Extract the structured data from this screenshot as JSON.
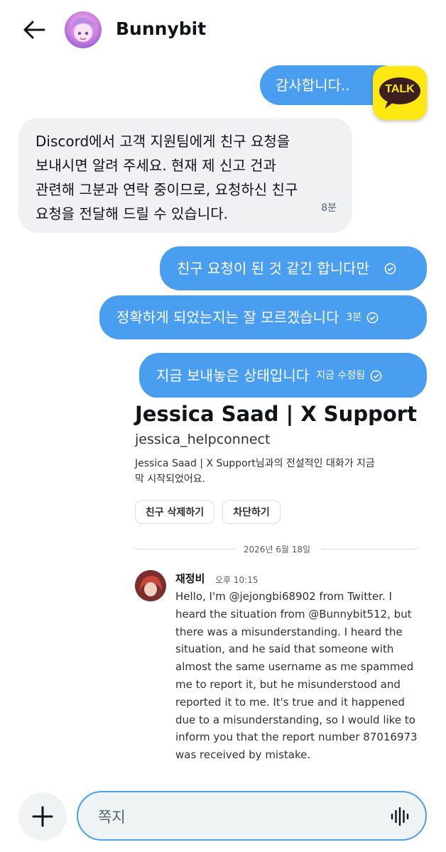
{
  "header": {
    "name": "Bunnybit"
  },
  "messages": {
    "m1": {
      "text": "감사합니다.."
    },
    "m2": {
      "line1": "Discord에서 고객 지원팀에게 친구 요청을",
      "line2": "보내시면 알려 주세요. 현재 제 신고 건과",
      "line3": "관련해 그분과 연락 중이므로, 요청하신 친구",
      "line4": "요청을 전달해 드릴 수 있습니다.",
      "time": "8분"
    },
    "m3": {
      "text": "친구 요청이 된 것 같긴 합니다만"
    },
    "m4": {
      "text": "정확하게 되었는지는 잘 모르겠습니다",
      "time": "3분"
    },
    "m5": {
      "text": "지금 보내놓은 상태입니다",
      "time": "지금 수정됨"
    }
  },
  "badge": {
    "label": "TALK"
  },
  "discord": {
    "name": "Jessica Saad | X Support",
    "username": "jessica_helpconnect",
    "intro1": "Jessica Saad | X Support님과의 전설적인 대화가 지금",
    "intro2": "막 시작되었어요.",
    "remove_friend": "친구 삭제하기",
    "block": "차단하기",
    "date": "2026년 6월 18일",
    "author": "재정비",
    "timestamp": "오후 10:15",
    "body": [
      "Hello, I'm @jejongbi68902 from Twitter. I",
      "heard the situation from @Bunnybit512, but",
      "there was a misunderstanding. I heard the",
      "situation, and he said that someone with",
      "almost the same username as me spammed",
      "me to report it, but he misunderstood and",
      "reported it to me. It's true and it happened",
      "due to a misunderstanding, so I would like to",
      "inform you that the report number 87016973",
      "was received by mistake."
    ]
  },
  "composer": {
    "placeholder": "쪽지"
  },
  "colors": {
    "accent": "#4a9ef0",
    "incoming": "#eff1f3",
    "talk_yellow": "#ffe812"
  },
  "icons": [
    "back-arrow-icon",
    "check-circle-icon",
    "plus-icon",
    "voice-wave-icon"
  ]
}
